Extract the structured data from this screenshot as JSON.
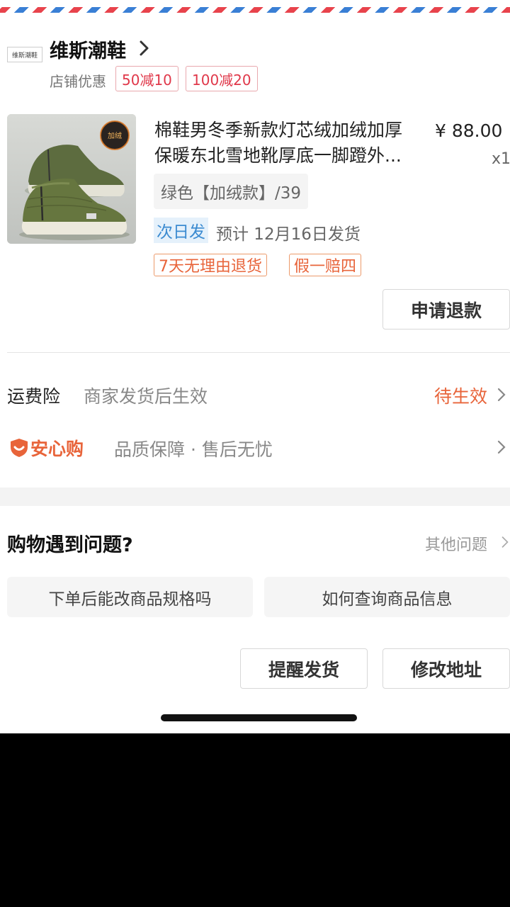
{
  "shop": {
    "name": "维斯潮鞋",
    "logo_text": "维斯潮鞋",
    "promo_label": "店铺优惠",
    "coupons": [
      "50减10",
      "100减20"
    ]
  },
  "product": {
    "title_line1": "棉鞋男冬季新款灯芯绒加绒加厚",
    "title_line2": "保暖东北雪地靴厚底一脚蹬外...",
    "price": "¥ 88.00",
    "quantity": "x1",
    "sku": "绿色【加绒款】/39",
    "badge_text": "加绒",
    "shipping_badge": "次日发",
    "eta": "预计 12月16日发货",
    "tags": [
      "7天无理由退货",
      "假一赔四"
    ],
    "refund_button": "申请退款"
  },
  "insurance": {
    "label": "运费险",
    "desc": "商家发货后生效",
    "status": "待生效"
  },
  "assurance": {
    "brand": "安心购",
    "desc": "品质保障 · 售后无忧"
  },
  "faq": {
    "title": "购物遇到问题?",
    "other": "其他问题",
    "questions": [
      "下单后能改商品规格吗",
      "如何查询商品信息"
    ]
  },
  "actions": {
    "remind": "提醒发货",
    "modify_address": "修改地址"
  },
  "colors": {
    "accent_orange": "#e8643a",
    "coupon_red": "#e0384a",
    "shipping_blue": "#3b8bd1"
  }
}
